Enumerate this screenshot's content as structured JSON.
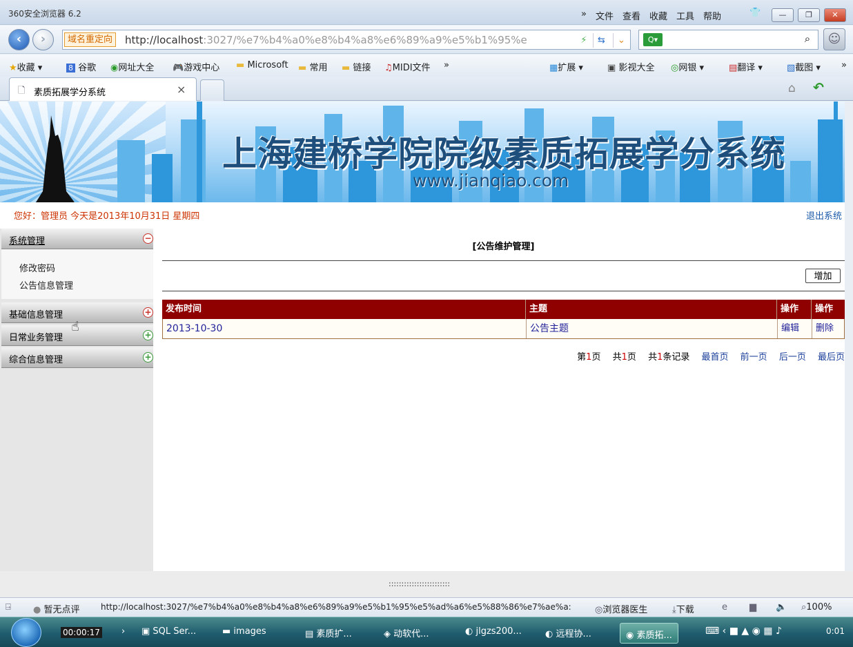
{
  "window": {
    "title": "360安全浏览器 6.2",
    "menus": [
      "»",
      "文件",
      "查看",
      "收藏",
      "工具",
      "帮助"
    ]
  },
  "address": {
    "redirect_label": "域名重定向",
    "url_host": "http://localhost",
    "url_rest": ":3027/%e7%b4%a0%e8%b4%a8%e6%89%a9%e5%b1%95%e"
  },
  "favorites": [
    {
      "icon": "star-icon",
      "label": "收藏 ▾"
    },
    {
      "icon": "google-icon",
      "label": "谷歌"
    },
    {
      "icon": "web-directory-icon",
      "label": "网址大全"
    },
    {
      "icon": "gamepad-icon",
      "label": "游戏中心"
    },
    {
      "icon": "folder-icon",
      "label": "Microsoft"
    },
    {
      "icon": "folder-icon",
      "label": "常用"
    },
    {
      "icon": "folder-icon",
      "label": "链接"
    },
    {
      "icon": "midi-icon",
      "label": "MIDI文件"
    },
    {
      "icon": "more-icon",
      "label": "»"
    },
    {
      "icon": "extension-icon",
      "label": "扩展 ▾"
    },
    {
      "icon": "video-icon",
      "label": "影视大全"
    },
    {
      "icon": "bank-icon",
      "label": "网银 ▾"
    },
    {
      "icon": "translate-icon",
      "label": "翻译 ▾"
    },
    {
      "icon": "screenshot-icon",
      "label": "截图 ▾"
    },
    {
      "icon": "more-icon",
      "label": "»"
    }
  ],
  "tab": {
    "label": "素质拓展学分系统"
  },
  "banner": {
    "title": "上海建桥学院院级素质拓展学分系统",
    "url": "www.jianqiao.com"
  },
  "header": {
    "welcome": "您好：管理员   今天是2013年10月31日   星期四",
    "logout": "退出系统"
  },
  "sidebar": {
    "groups": [
      {
        "label": "系统管理",
        "expanded": true,
        "items": [
          "修改密码",
          "公告信息管理"
        ]
      },
      {
        "label": "基础信息管理",
        "expanded": false
      },
      {
        "label": "日常业务管理",
        "expanded": false
      },
      {
        "label": "综合信息管理",
        "expanded": false
      }
    ]
  },
  "main": {
    "title": "[公告维护管理]",
    "add_button": "增加",
    "columns": [
      "发布时间",
      "主题",
      "操作",
      "操作"
    ],
    "rows": [
      {
        "date": "2013-10-30",
        "subject": "公告主题",
        "edit": "编辑",
        "delete": "删除"
      }
    ],
    "pager": {
      "page_prefix": "第",
      "page_no": "1",
      "page_suffix": "页",
      "total_prefix": "共",
      "total_pages": "1",
      "total_suffix": "页",
      "records_prefix": "共",
      "records": "1",
      "records_suffix": "条记录",
      "first": "最首页",
      "prev": "前一页",
      "next": "后一页",
      "last": "最后页"
    }
  },
  "status": {
    "rating": "暂无点评",
    "url": "http://localhost:3027/%e7%b4%a0%e8%b4%a8%e6%89%a9%e5%b1%95%e5%ad%a6%e5%88%86%e7%ae%a:",
    "doctor": "浏览器医生",
    "download": "下载",
    "zoom": "100%"
  },
  "taskbar": {
    "timer": "00:00:17",
    "items": [
      "SQL Ser...",
      "images",
      "素质扩...",
      "动软代...",
      "jlgzs200...",
      "远程协...",
      "素质拓..."
    ],
    "clock": "0:01"
  }
}
